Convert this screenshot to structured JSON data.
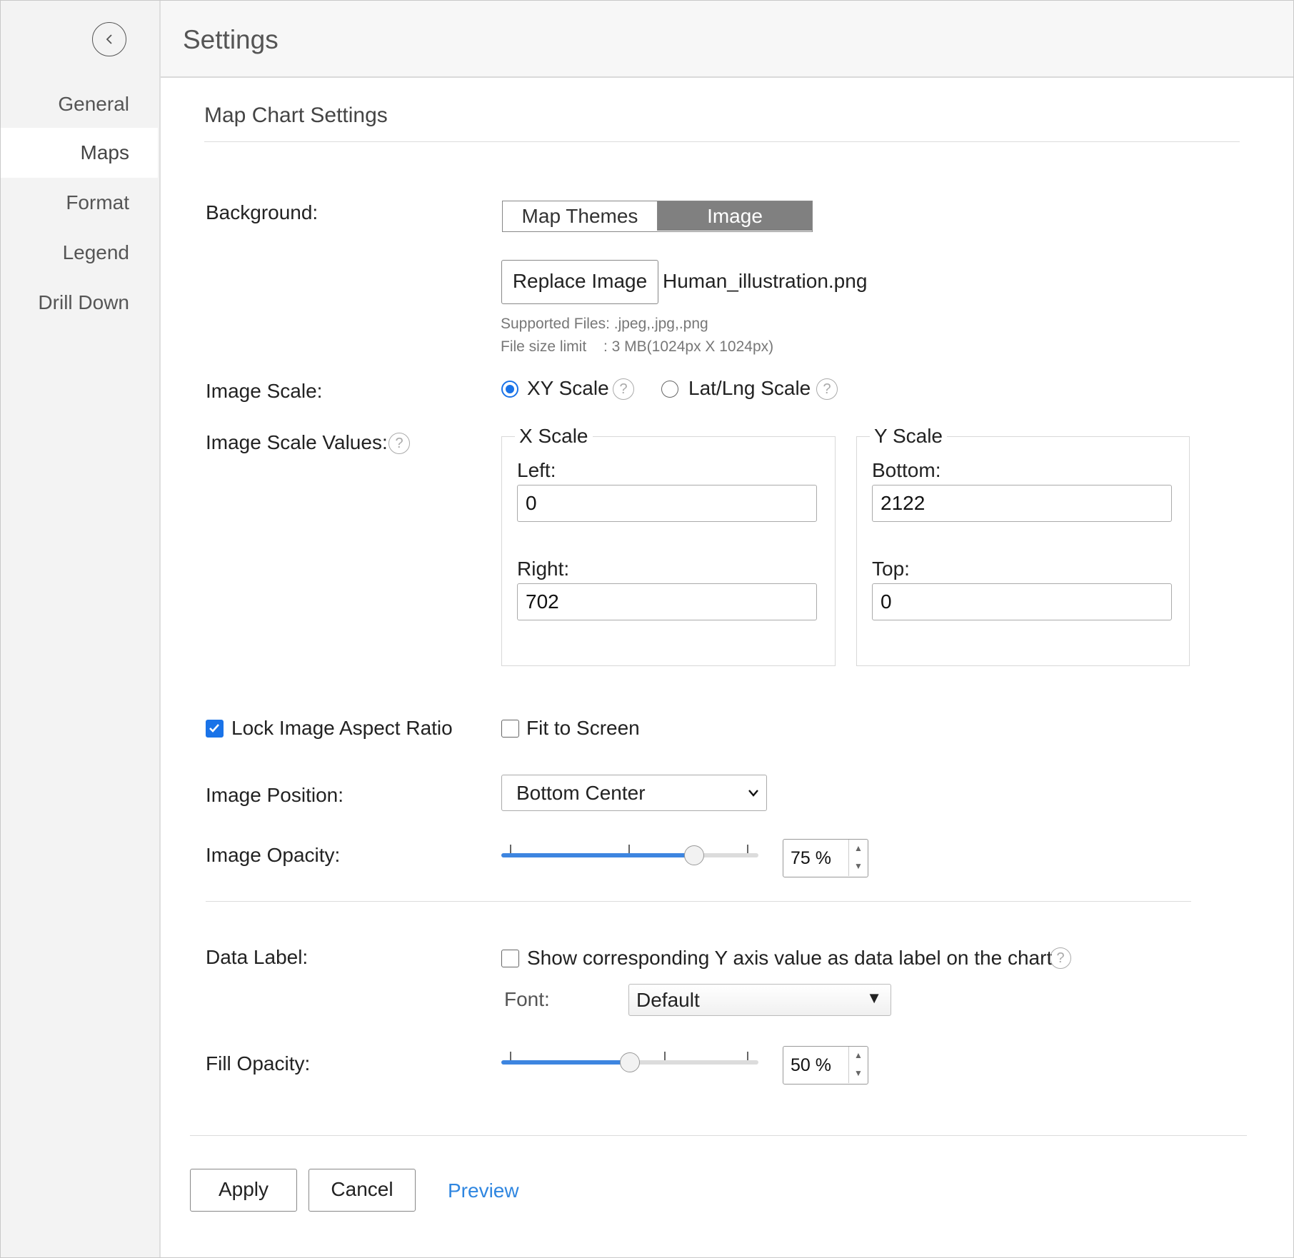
{
  "header": {
    "title": "Settings"
  },
  "sidebar": {
    "items": [
      {
        "label": "General"
      },
      {
        "label": "Maps"
      },
      {
        "label": "Format"
      },
      {
        "label": "Legend"
      },
      {
        "label": "Drill Down"
      }
    ],
    "active_index": 1
  },
  "section": {
    "title": "Map Chart Settings"
  },
  "background": {
    "label": "Background:",
    "options": [
      "Map Themes",
      "Image"
    ],
    "selected": "Image",
    "replace_button": "Replace Image",
    "file_name": "Human_illustration.png",
    "supported_files": "Supported Files: .jpeg,.jpg,.png",
    "size_limit_label": "File size limit",
    "size_limit_value": ": 3 MB(1024px X 1024px)"
  },
  "image_scale": {
    "label": "Image Scale:",
    "options": [
      "XY Scale",
      "Lat/Lng Scale"
    ],
    "selected": "XY Scale"
  },
  "scale_values": {
    "label": "Image Scale Values:",
    "x_scale": {
      "legend": "X Scale",
      "left_label": "Left:",
      "left_value": "0",
      "right_label": "Right:",
      "right_value": "702"
    },
    "y_scale": {
      "legend": "Y Scale",
      "bottom_label": "Bottom:",
      "bottom_value": "2122",
      "top_label": "Top:",
      "top_value": "0"
    }
  },
  "options": {
    "lock_aspect": {
      "label": "Lock Image Aspect Ratio",
      "checked": true
    },
    "fit_screen": {
      "label": "Fit to Screen",
      "checked": false
    }
  },
  "image_position": {
    "label": "Image Position:",
    "value": "Bottom Center"
  },
  "image_opacity": {
    "label": "Image Opacity:",
    "value": 75,
    "display": "75 %"
  },
  "data_label": {
    "label": "Data Label:",
    "checkbox_label": "Show corresponding Y axis value as data label on the chart",
    "checked": false,
    "font_label": "Font:",
    "font_value": "Default"
  },
  "fill_opacity": {
    "label": "Fill Opacity:",
    "value": 50,
    "display": "50 %"
  },
  "footer": {
    "apply": "Apply",
    "cancel": "Cancel",
    "preview": "Preview"
  },
  "colors": {
    "accent": "#1a73e8",
    "slider_fill": "#3d85e0",
    "link": "#2f86e0",
    "segment_active": "#808080"
  }
}
